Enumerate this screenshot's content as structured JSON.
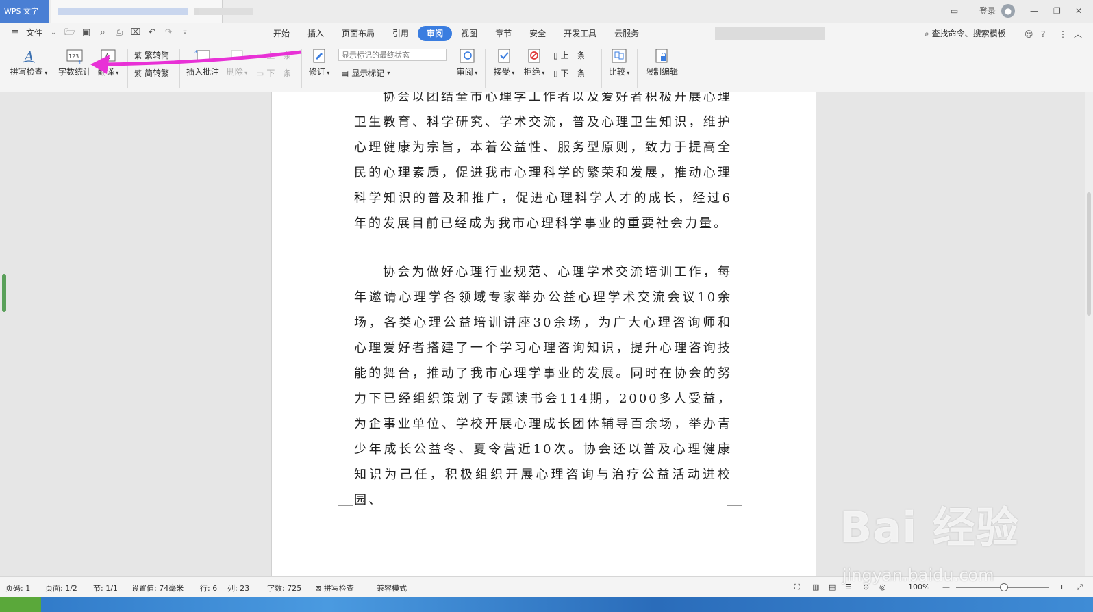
{
  "app": {
    "badge": "WPS 文字"
  },
  "window_controls": {
    "login": "登录"
  },
  "menubar": {
    "file": "文件",
    "tabs": [
      "开始",
      "插入",
      "页面布局",
      "引用",
      "审阅",
      "视图",
      "章节",
      "安全",
      "开发工具",
      "云服务"
    ],
    "active_tab": "审阅",
    "search": "查找命令、搜索模板"
  },
  "ribbon": {
    "spell_check": "拼写检查",
    "word_count": "字数统计",
    "translate": "翻译",
    "trad_to_simp": "繁转简",
    "simp_to_trad": "简转繁",
    "insert_comment": "插入批注",
    "delete": "删除",
    "prev_comment": "上一条",
    "next_comment": "下一条",
    "revise": "修订",
    "markup_state": "显示标记的最终状态",
    "show_markup": "显示标记",
    "review": "审阅",
    "accept": "接受",
    "reject": "拒绝",
    "prev": "上一条",
    "next": "下一条",
    "compare": "比较",
    "restrict_edit": "限制编辑"
  },
  "document": {
    "paragraphs": [
      "协会以团结全市心理学工作者以及爱好者积极开展心理卫生教育、科学研究、学术交流，普及心理卫生知识，维护心理健康为宗旨，本着公益性、服务型原则，致力于提高全民的心理素质，促进我市心理科学的繁荣和发展，推动心理科学知识的普及和推广，促进心理科学人才的成长，经过6年的发展目前已经成为我市心理科学事业的重要社会力量。",
      "协会为做好心理行业规范、心理学术交流培训工作，每年邀请心理学各领域专家举办公益心理学术交流会议10余场，各类心理公益培训讲座30余场，为广大心理咨询师和心理爱好者搭建了一个学习心理咨询知识，提升心理咨询技能的舞台，推动了我市心理学事业的发展。同时在协会的努力下已经组织策划了专题读书会114期，2000多人受益，为企事业单位、学校开展心理成长团体辅导百余场，举办青少年成长公益冬、夏令营近10次。协会还以普及心理健康知识为己任，积极组织开展心理咨询与治疗公益活动进校园、"
    ]
  },
  "status": {
    "page": "页码: 1",
    "pages": "页面: 1/2",
    "section": "节: 1/1",
    "setting": "设置值: 74毫米",
    "row": "行: 6",
    "col": "列: 23",
    "words": "字数: 725",
    "spell": "拼写检查",
    "compat": "兼容模式",
    "zoom": "100%"
  },
  "watermark": {
    "main": "Bai 经验",
    "sub": "jingyan.baidu.com"
  },
  "colors": {
    "accent": "#3a7de0",
    "arrow": "#e831d6"
  }
}
